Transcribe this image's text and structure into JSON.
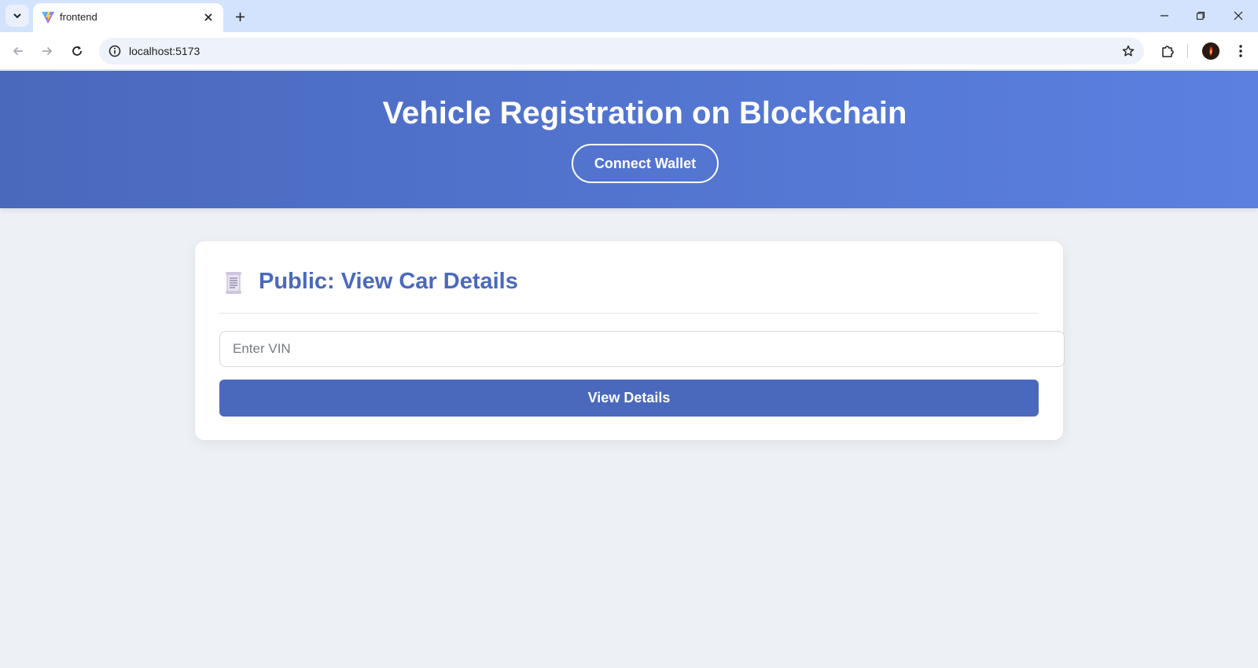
{
  "browser": {
    "tab_title": "frontend",
    "url": "localhost:5173"
  },
  "header": {
    "title": "Vehicle Registration on Blockchain",
    "connect_label": "Connect Wallet",
    "gradient_start": "#4a69bd",
    "gradient_end": "#5b80e0"
  },
  "card": {
    "title": "Public: View Car Details",
    "icon": "scroll-icon",
    "vin_placeholder": "Enter VIN",
    "vin_value": "",
    "view_label": "View Details",
    "accent": "#4a69bd"
  }
}
